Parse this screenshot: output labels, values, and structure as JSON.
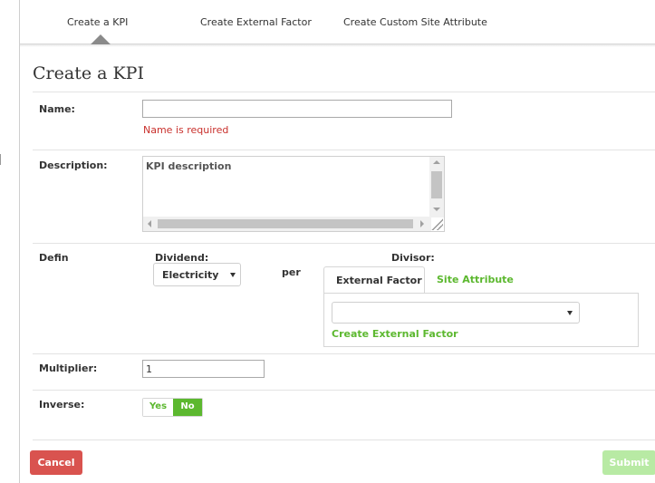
{
  "tabs": {
    "create_kpi": "Create a KPI",
    "create_external_factor": "Create External Factor",
    "create_custom_site_attribute": "Create Custom Site Attribute",
    "active": "Create a KPI"
  },
  "page_title": "Create a KPI",
  "form": {
    "name": {
      "label": "Name:",
      "value": "",
      "error": "Name is required"
    },
    "description": {
      "label": "Description:",
      "placeholder": "KPI description"
    },
    "define": {
      "label": "Defin",
      "dividend_label": "Dividend:",
      "dividend_value": "Electricity",
      "per_text": "per",
      "divisor_label": "Divisor:",
      "divisor_tabs": [
        "External Factor",
        "Site Attribute"
      ],
      "divisor_active_tab": "External Factor",
      "external_factor_value": "",
      "create_external_factor_link": "Create External Factor"
    },
    "multiplier": {
      "label": "Multiplier:",
      "value": "1"
    },
    "inverse": {
      "label": "Inverse:",
      "yes": "Yes",
      "no": "No",
      "selected": "No"
    }
  },
  "buttons": {
    "cancel": "Cancel",
    "submit": "Submit"
  },
  "colors": {
    "accent_green": "#5cb82f",
    "error_red": "#c9302c",
    "cancel_red": "#d9534f",
    "submit_disabled_green": "#b8eaa4"
  }
}
